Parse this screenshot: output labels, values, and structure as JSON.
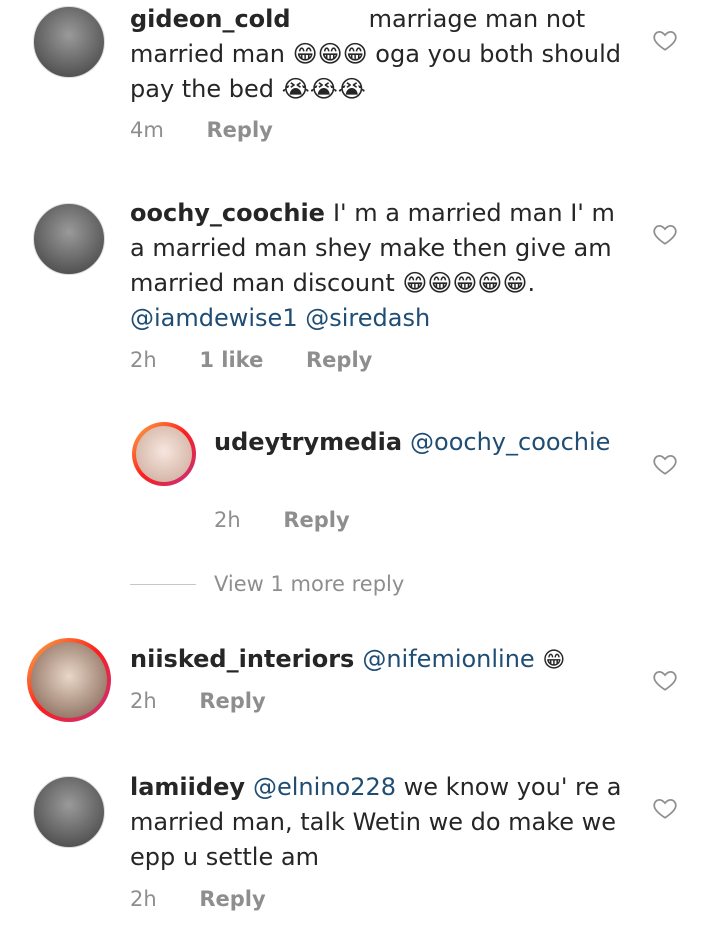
{
  "comments": [
    {
      "username": "gideon_cold",
      "text": "marriage man not married man 😁😁😁 oga you both should pay the bed 😭😭😭",
      "time": "4m",
      "reply": "Reply"
    },
    {
      "username": "oochy_coochie",
      "text": "I' m a married man I' m a married man shey make then give am married man discount 😁😁😁😁😁.",
      "mention1": "@iamdewise1",
      "mention2": "@siredash",
      "time": "2h",
      "likes": "1 like",
      "reply": "Reply"
    },
    {
      "username": "udeytrymedia",
      "mention": "@oochy_coochie",
      "time": "2h",
      "reply": "Reply"
    },
    {
      "username": "niisked_interiors",
      "mention": "@nifemionline",
      "emoji": "😁",
      "time": "2h",
      "reply": "Reply"
    },
    {
      "username": "lamiidey",
      "mention": "@elnino228",
      "text": "we know you' re a married man, talk Wetin we do make we epp u settle am",
      "time": "2h",
      "reply": "Reply"
    }
  ],
  "view_more": "View 1 more reply",
  "icons": {
    "like": "heart-outline-icon"
  },
  "colors": {
    "mention": "#1f4d73",
    "meta": "#8e8e8e",
    "text": "#262626"
  }
}
